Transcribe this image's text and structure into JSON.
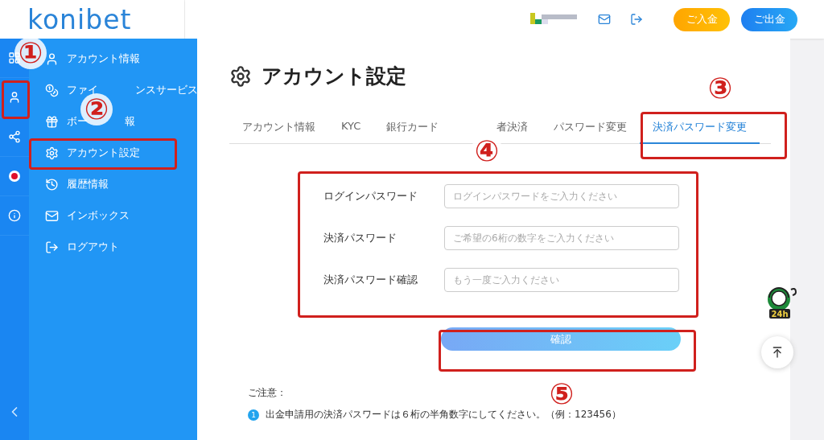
{
  "header": {
    "logo": "konibet",
    "actions": [
      {
        "kind": "mail"
      },
      {
        "kind": "logout"
      }
    ],
    "buttons": [
      {
        "label": "ご入金",
        "kind": "deposit"
      },
      {
        "label": "ご出金",
        "kind": "withdraw"
      }
    ]
  },
  "rail": {
    "items": [
      {
        "kind": "grid"
      },
      {
        "kind": "user"
      },
      {
        "kind": "share"
      },
      {
        "kind": "dot"
      },
      {
        "kind": "info"
      }
    ],
    "collapse": {
      "kind": "chevron"
    }
  },
  "sidebar": {
    "items": [
      {
        "kind": "user",
        "label_parts": [
          "アカウント情報"
        ]
      },
      {
        "kind": "coins",
        "label_parts": [
          "ファイ",
          "ンスサービス"
        ]
      },
      {
        "kind": "gift",
        "label_parts": [
          "ボー",
          "報"
        ]
      },
      {
        "kind": "gear",
        "label_parts": [
          "アカウント設定"
        ]
      },
      {
        "kind": "history",
        "label_parts": [
          "履歴情報"
        ]
      },
      {
        "kind": "mail",
        "label_parts": [
          "インボックス"
        ]
      },
      {
        "kind": "logout",
        "label_parts": [
          "ログアウト"
        ]
      }
    ]
  },
  "page": {
    "title": "アカウント設定",
    "tabs": [
      {
        "label": "アカウント情報",
        "selected": false
      },
      {
        "label": "KYC",
        "selected": false
      },
      {
        "label": "銀行カード",
        "selected": false
      },
      {
        "label": "者決済",
        "selected": false
      },
      {
        "label": "パスワード変更",
        "selected": false
      },
      {
        "label": "決済パスワード変更",
        "selected": true
      }
    ],
    "form": [
      {
        "label": "ログインパスワード",
        "placeholder": "ログインパスワードをご入力ください"
      },
      {
        "label": "決済パスワード",
        "placeholder": "ご希望の6桁の数字をご入力ください"
      },
      {
        "label": "決済パスワード確認",
        "placeholder": "もう一度ご入力ください"
      }
    ],
    "submit": "確認",
    "notes_title": "ご注意：",
    "notes": [
      {
        "number": "1",
        "text": "出金申請用の決済パスワードは６桁の半角数字にしてください。（例：123456）"
      }
    ]
  },
  "support": {
    "badge": "24h"
  },
  "annotations": [
    "①",
    "②",
    "③",
    "④",
    "⑤"
  ]
}
